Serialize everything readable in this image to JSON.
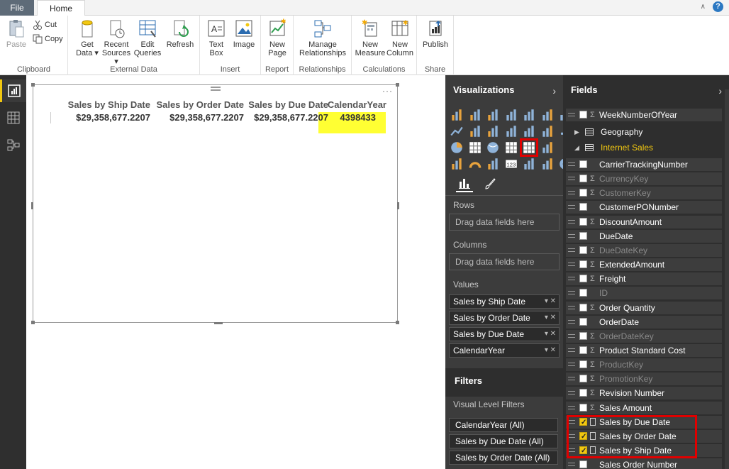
{
  "tabs": {
    "file": "File",
    "home": "Home"
  },
  "window": {
    "help": "?"
  },
  "ribbon": {
    "clipboard": {
      "label": "Clipboard",
      "paste": "Paste",
      "cut": "Cut",
      "copy": "Copy"
    },
    "external_data": {
      "label": "External Data",
      "get_data": "Get",
      "get_data2": "Data ▾",
      "recent_sources": "Recent",
      "recent_sources2": "Sources ▾",
      "edit_queries": "Edit",
      "edit_queries2": "Queries",
      "refresh": "Refresh"
    },
    "insert": {
      "label": "Insert",
      "text_box": "Text",
      "text_box2": "Box",
      "image": "Image"
    },
    "report": {
      "label": "Report",
      "new_page": "New",
      "new_page2": "Page"
    },
    "relationships": {
      "label": "Relationships",
      "manage": "Manage",
      "manage2": "Relationships"
    },
    "calculations": {
      "label": "Calculations",
      "new_measure": "New",
      "new_measure2": "Measure",
      "new_column": "New",
      "new_column2": "Column"
    },
    "share": {
      "label": "Share",
      "publish": "Publish"
    }
  },
  "visual": {
    "headers": [
      "Sales by Ship Date",
      "Sales by Order Date",
      "Sales by Due Date",
      "CalendarYear"
    ],
    "values": [
      "$29,358,677.2207",
      "$29,358,677.2207",
      "$29,358,677.2207",
      "4398433"
    ],
    "menu": "···"
  },
  "visualizations": {
    "title": "Visualizations",
    "rows_label": "Rows",
    "columns_label": "Columns",
    "values_label": "Values",
    "drop_hint": "Drag data fields here",
    "values": [
      "Sales by Ship Date",
      "Sales by Order Date",
      "Sales by Due Date",
      "CalendarYear"
    ],
    "filters_title": "Filters",
    "visual_level_filters": "Visual Level Filters",
    "filters": [
      "CalendarYear (All)",
      "Sales by Due Date (All)",
      "Sales by Order Date (All)"
    ]
  },
  "fields": {
    "title": "Fields",
    "top_field": "WeekNumberOfYear",
    "tables": [
      "Geography",
      "Internet Sales"
    ],
    "items": [
      {
        "name": "CarrierTrackingNumber",
        "sigma": false,
        "dim": false,
        "checked": false
      },
      {
        "name": "CurrencyKey",
        "sigma": true,
        "dim": true,
        "checked": false
      },
      {
        "name": "CustomerKey",
        "sigma": true,
        "dim": true,
        "checked": false
      },
      {
        "name": "CustomerPONumber",
        "sigma": false,
        "dim": false,
        "checked": false
      },
      {
        "name": "DiscountAmount",
        "sigma": true,
        "dim": false,
        "checked": false
      },
      {
        "name": "DueDate",
        "sigma": false,
        "dim": false,
        "checked": false
      },
      {
        "name": "DueDateKey",
        "sigma": true,
        "dim": true,
        "checked": false
      },
      {
        "name": "ExtendedAmount",
        "sigma": true,
        "dim": false,
        "checked": false
      },
      {
        "name": "Freight",
        "sigma": true,
        "dim": false,
        "checked": false
      },
      {
        "name": "ID",
        "sigma": false,
        "dim": true,
        "checked": false
      },
      {
        "name": "Order Quantity",
        "sigma": true,
        "dim": false,
        "checked": false
      },
      {
        "name": "OrderDate",
        "sigma": false,
        "dim": false,
        "checked": false
      },
      {
        "name": "OrderDateKey",
        "sigma": true,
        "dim": true,
        "checked": false
      },
      {
        "name": "Product Standard Cost",
        "sigma": true,
        "dim": false,
        "checked": false
      },
      {
        "name": "ProductKey",
        "sigma": true,
        "dim": true,
        "checked": false
      },
      {
        "name": "PromotionKey",
        "sigma": true,
        "dim": true,
        "checked": false
      },
      {
        "name": "Revision Number",
        "sigma": true,
        "dim": false,
        "checked": false
      },
      {
        "name": "Sales Amount",
        "sigma": true,
        "dim": false,
        "checked": false
      },
      {
        "name": "Sales by Due Date",
        "sigma": false,
        "dim": false,
        "checked": true
      },
      {
        "name": "Sales by Order Date",
        "sigma": false,
        "dim": false,
        "checked": true
      },
      {
        "name": "Sales by Ship Date",
        "sigma": false,
        "dim": false,
        "checked": true
      },
      {
        "name": "Sales Order Number",
        "sigma": false,
        "dim": false,
        "checked": false
      }
    ]
  },
  "colors": {
    "accent": "#f2c811",
    "highlight": "#ffff33",
    "annotation": "#e00000",
    "rail": "#2f2f2f",
    "pane": "#3c3c3c"
  },
  "icons": [
    "paste-icon",
    "cut-icon",
    "copy-icon",
    "get-data-icon",
    "recent-sources-icon",
    "edit-queries-icon",
    "refresh-icon",
    "text-box-icon",
    "image-icon",
    "new-page-icon",
    "manage-relationships-icon",
    "new-measure-icon",
    "new-column-icon",
    "publish-icon",
    "report-view-icon",
    "data-view-icon",
    "relationships-view-icon",
    "fields-tab-icon",
    "format-brush-icon"
  ]
}
